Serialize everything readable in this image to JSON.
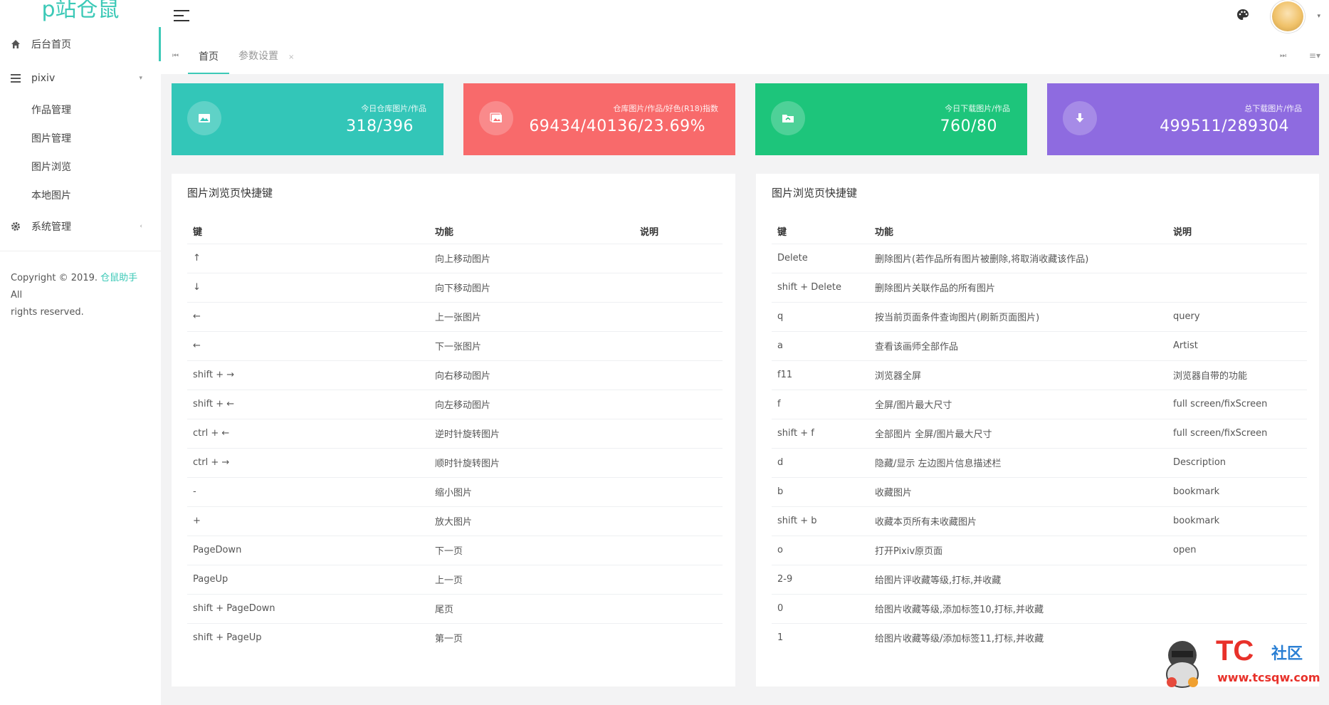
{
  "brand": "p站仓鼠",
  "sidebar": {
    "items": [
      {
        "label": "后台首页",
        "icon": "home-icon"
      },
      {
        "label": "pixiv",
        "icon": "list-icon"
      },
      {
        "label": "系统管理",
        "icon": "gear-icon"
      }
    ],
    "subitems": [
      "作品管理",
      "图片管理",
      "图片浏览",
      "本地图片"
    ],
    "copyright_prefix": "Copyright © 2019.",
    "copyright_link": "仓鼠助手",
    "copyright_suffix": "All",
    "copyright_line2": "rights reserved."
  },
  "tabs": [
    "首页",
    "参数设置"
  ],
  "cards": [
    {
      "label": "今日仓库图片/作品",
      "value": "318/396",
      "color": "#33c6b8",
      "icon": "image-icon"
    },
    {
      "label": "仓库图片/作品/好色(R18)指数",
      "value": "69434/40136/23.69%",
      "color": "#f86a6b",
      "icon": "images-icon"
    },
    {
      "label": "今日下载图片/作品",
      "value": "760/80",
      "color": "#1dc57b",
      "icon": "folder-icon"
    },
    {
      "label": "总下载图片/作品",
      "value": "499511/289304",
      "color": "#8e6be0",
      "icon": "download-icon"
    }
  ],
  "left_panel": {
    "title": "图片浏览页快捷键",
    "headers": [
      "键",
      "功能",
      "说明"
    ],
    "rows": [
      [
        "↑",
        "向上移动图片",
        ""
      ],
      [
        "↓",
        "向下移动图片",
        ""
      ],
      [
        "←",
        "上一张图片",
        ""
      ],
      [
        "←",
        "下一张图片",
        ""
      ],
      [
        "shift + →",
        "向右移动图片",
        ""
      ],
      [
        "shift + ←",
        "向左移动图片",
        ""
      ],
      [
        "ctrl + ←",
        "逆时针旋转图片",
        ""
      ],
      [
        "ctrl + →",
        "顺时针旋转图片",
        ""
      ],
      [
        "-",
        "缩小图片",
        ""
      ],
      [
        "+",
        "放大图片",
        ""
      ],
      [
        "PageDown",
        "下一页",
        ""
      ],
      [
        "PageUp",
        "上一页",
        ""
      ],
      [
        "shift + PageDown",
        "尾页",
        ""
      ],
      [
        "shift + PageUp",
        "第一页",
        ""
      ]
    ]
  },
  "right_panel": {
    "title": "图片浏览页快捷键",
    "headers": [
      "键",
      "功能",
      "说明"
    ],
    "rows": [
      [
        "Delete",
        "删除图片(若作品所有图片被删除,将取消收藏该作品)",
        ""
      ],
      [
        "shift + Delete",
        "删除图片关联作品的所有图片",
        ""
      ],
      [
        "q",
        "按当前页面条件查询图片(刷新页面图片)",
        "query"
      ],
      [
        "a",
        "查看该画师全部作品",
        "Artist"
      ],
      [
        "f11",
        "浏览器全屏",
        "浏览器自带的功能"
      ],
      [
        "f",
        "全屏/图片最大尺寸",
        "full screen/fixScreen"
      ],
      [
        "shift + f",
        "全部图片 全屏/图片最大尺寸",
        "full screen/fixScreen"
      ],
      [
        "d",
        "隐藏/显示 左边图片信息描述栏",
        "Description"
      ],
      [
        "b",
        "收藏图片",
        "bookmark"
      ],
      [
        "shift + b",
        "收藏本页所有未收藏图片",
        "bookmark"
      ],
      [
        "o",
        "打开Pixiv原页面",
        "open"
      ],
      [
        "2-9",
        "给图片评收藏等级,打标,并收藏",
        ""
      ],
      [
        "0",
        "给图片收藏等级,添加标签10,打标,并收藏",
        ""
      ],
      [
        "1",
        "给图片收藏等级/添加标签11,打标,并收藏",
        ""
      ]
    ]
  },
  "watermark": {
    "brand": "TC",
    "suffix": "社区",
    "url": "www.tcsqw.com"
  }
}
